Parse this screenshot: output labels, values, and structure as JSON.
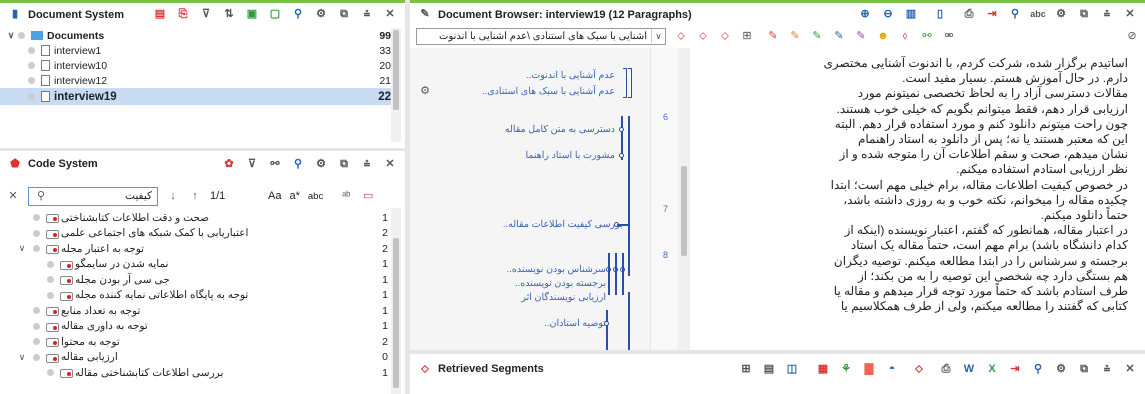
{
  "docsys": {
    "title": "Document System",
    "root": {
      "label": "Documents",
      "count": "99"
    },
    "items": [
      {
        "label": "interview1",
        "count": "33"
      },
      {
        "label": "interview10",
        "count": "20"
      },
      {
        "label": "interview12",
        "count": "21"
      },
      {
        "label": "interview19",
        "count": "22"
      }
    ]
  },
  "codesys": {
    "title": "Code System",
    "search_value": "کیفیت",
    "nav": "1/1",
    "aa": "Aa",
    "astar": "a*",
    "abc": "abc",
    "items": [
      {
        "label": "صحت و دقت اطلاعات کتابشناختی",
        "count": "1"
      },
      {
        "label": "اعتباریابی با کمک شبکه های اجتماعی علمی",
        "count": "2"
      },
      {
        "label": "توجه به اعتبار مجله",
        "count": "2"
      },
      {
        "label": "نمایه شدن در سایمگو",
        "count": "1"
      },
      {
        "label": "جی سی آر بودن مجله",
        "count": "1"
      },
      {
        "label": "توجه به پایگاه اطلاعاتی نمایه کننده مجله",
        "count": "1"
      },
      {
        "label": "توجه به تعداد منابع",
        "count": "1"
      },
      {
        "label": "توجه به داوری مقاله",
        "count": "1"
      },
      {
        "label": "توجه به محتوا",
        "count": "2"
      },
      {
        "label": "ارزیابی مقاله",
        "count": "0"
      },
      {
        "label": "بررسی اطلاعات کتابشناختی مقاله",
        "count": "1"
      }
    ]
  },
  "browser": {
    "title": "Document Browser: interview19  (12 Paragraphs)",
    "code_select": "آشنایی با سبک های استنادی \\عدم آشنایی با اندنوت",
    "segments": [
      "عدم آشنایی با اندنوت..",
      "عدم آشنایی با سبک های استنادی..",
      "دسترسی به متن کامل مقاله",
      "مشورت با استاد راهنما",
      "بررسی کیفیت اطلاعات مقاله..",
      "سرشناس بودن نویسنده..",
      "برجسته بودن نویسنده..",
      "ارزیابی نویسندگان اثر",
      "توصیه استادان.."
    ],
    "paragraph_numbers": [
      "6",
      "7",
      "8"
    ],
    "lines": [
      "اساتیدم برگزار شده، شرکت کردم، با اندنوت آشنایی مختصری",
      "دارم. در حال آموزش هستم. بسیار مفید است.",
      "مقالات دسترسی آزاد را به لحاظ تخصصی نمیتونم مورد",
      "ارزیابی قرار دهم، فقط میتوانم بگویم که خیلی خوب هستند.",
      "چون راحت میتونم دانلود کنم و مورد استفاده قرار دهم. البته",
      "این که معتبر هستند یا نه؛ پس از دانلود به استاد راهنمام",
      "نشان میدهم، صحت و سقم اطلاعات آن را متوجه شده و از",
      "نظر ارزیابی استادم استفاده میکنم.",
      "در خصوص کیفیت اطلاعات مقاله، برام خیلی مهم است؛ ابتدا",
      "چکیده مقاله را میخوانم، نکته خوب و به روزی داشته باشد،",
      "حتماً دانلود میکنم.",
      "در اعتبار مقاله، همانطور که گفتم، اعتبار نویسنده (اینکه از",
      "کدام دانشگاه باشد) برام مهم است، حتماً مقاله یک استاد",
      "برجسته و سرشناس را در ابتدا مطالعه میکنم. توصیه دیگران",
      "هم بستگی دارد چه شخصی این توصیه را به من بکند؛ از",
      "طرف استادم باشد که حتماً مورد توجه قرار میدهم و مقاله یا",
      "کتابی که گفتند را مطالعه میکنم، ولی از طرف همکلاسیم یا"
    ]
  },
  "retrieved": {
    "title": "Retrieved Segments"
  },
  "colors": {
    "accent": "#7cc242",
    "link": "#3a63b5",
    "code_line": "#2b4fa8"
  }
}
